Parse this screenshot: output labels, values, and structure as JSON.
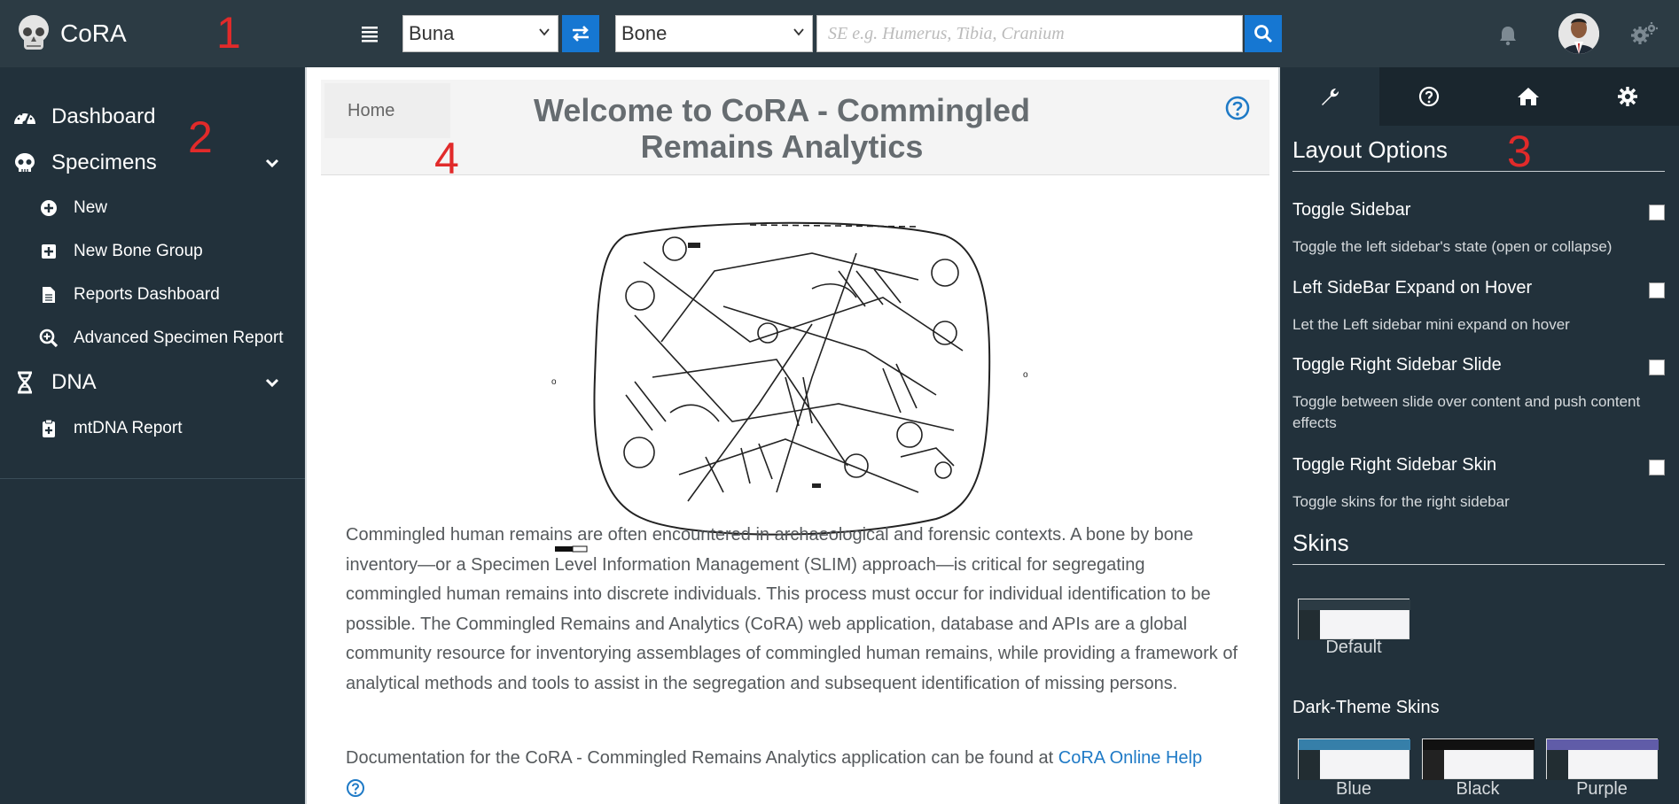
{
  "app": {
    "name": "CoRA"
  },
  "annotations": {
    "one": "1",
    "two": "2",
    "three": "3",
    "four": "4"
  },
  "toolbar": {
    "project_select": "Buna",
    "bone_select": "Bone",
    "search_placeholder": "SE e.g. Humerus, Tibia, Cranium",
    "icons": [
      "menu-icon",
      "swap-icon",
      "search-icon",
      "bell-icon",
      "avatar",
      "gears-icon"
    ]
  },
  "sidebar": {
    "items": [
      {
        "label": "Dashboard",
        "icon": "dashboard-icon"
      },
      {
        "label": "Specimens",
        "icon": "skull-icon"
      },
      {
        "label": "New",
        "icon": "plus-circle-icon"
      },
      {
        "label": "New Bone Group",
        "icon": "plus-square-icon"
      },
      {
        "label": "Reports Dashboard",
        "icon": "file-icon"
      },
      {
        "label": "Advanced Specimen Report",
        "icon": "search-plus-icon"
      },
      {
        "label": "DNA",
        "icon": "dna-icon"
      },
      {
        "label": "mtDNA Report",
        "icon": "clipboard-plus-icon"
      }
    ]
  },
  "main": {
    "breadcrumb": "Home",
    "title": "Welcome to CoRA - Commingled Remains Analytics",
    "paragraph": "Commingled human remains are often encountered in archaeological and forensic contexts. A bone by bone inventory—or a Specimen Level Information Management (SLIM) approach—is critical for segregating commingled human remains into discrete individuals. This process must occur for individual identification to be possible. The Commingled Remains and Analytics (CoRA) web application, database and APIs are a global community resource for inventorying assemblages of commingled human remains, while providing a framework of analytical methods and tools to assist in the segregation and subsequent identification of missing persons.",
    "doc_text": "Documentation for the CoRA - Commingled Remains Analytics application can be found at ",
    "doc_link": "CoRA Online Help"
  },
  "rightbar": {
    "tabs": [
      "wrench-icon",
      "question-icon",
      "home-icon",
      "gear-icon"
    ],
    "layout_heading": "Layout Options",
    "options": [
      {
        "title": "Toggle Sidebar",
        "desc": "Toggle the left sidebar's state (open or collapse)"
      },
      {
        "title": "Left SideBar Expand on Hover",
        "desc": "Let the Left sidebar mini expand on hover"
      },
      {
        "title": "Toggle Right Sidebar Slide",
        "desc": "Toggle between slide over content and push content effects"
      },
      {
        "title": "Toggle Right Sidebar Skin",
        "desc": "Toggle skins for the right sidebar"
      }
    ],
    "skins_heading": "Skins",
    "default_skin": "Default",
    "dark_heading": "Dark-Theme Skins",
    "dark_skins": [
      {
        "label": "Blue",
        "color": "#367fa9"
      },
      {
        "label": "Black",
        "color": "#111111"
      },
      {
        "label": "Purple",
        "color": "#605ca8"
      }
    ]
  },
  "colors": {
    "accent": "#1677d2",
    "sidebar": "#22313b",
    "topbar": "#2c3b44",
    "annotation": "#e12a2a"
  }
}
